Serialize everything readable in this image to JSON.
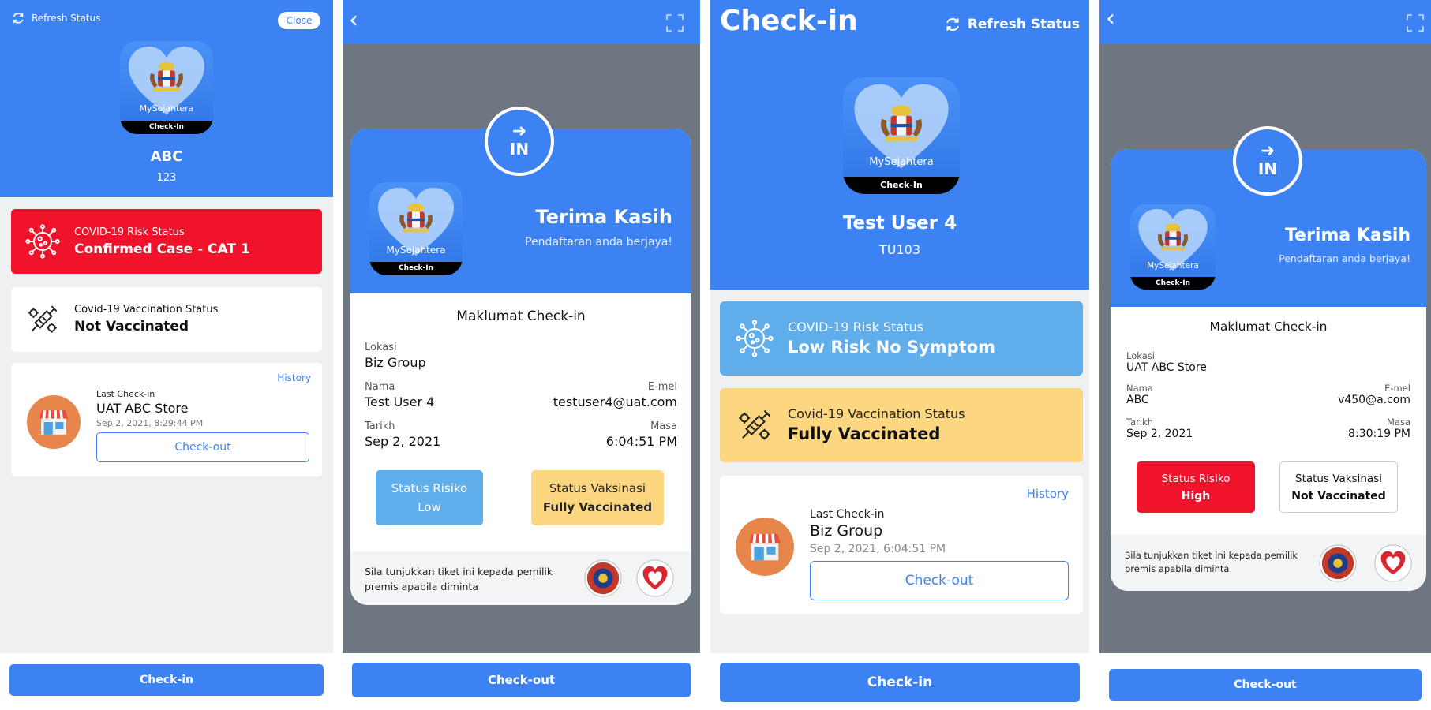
{
  "colors": {
    "brand": "#3d82f2",
    "danger": "#f0132b",
    "risk_low": "#5fadea",
    "vacc_full": "#fcd77f"
  },
  "panel1": {
    "refresh_label": "Refresh Status",
    "close_label": "Close",
    "app": {
      "brand": "MySejahtera",
      "band": "Check-In"
    },
    "user_name": "ABC",
    "user_id": "123",
    "risk": {
      "title": "COVID-19 Risk Status",
      "value": "Confirmed Case - CAT 1"
    },
    "vaccination": {
      "title": "Covid-19 Vaccination Status",
      "value": "Not Vaccinated"
    },
    "last_checkin": {
      "history": "History",
      "label": "Last Check-in",
      "place": "UAT ABC Store",
      "time": "Sep 2, 2021, 8:29:44 PM",
      "checkout": "Check-out"
    },
    "bottom_button": "Check-in"
  },
  "panel2": {
    "in_label": "IN",
    "app": {
      "brand": "MySejahtera",
      "band": "Check-In"
    },
    "thanks": "Terima Kasih",
    "success": "Pendaftaran anda berjaya!",
    "section_title": "Maklumat Check-in",
    "lokasi_label": "Lokasi",
    "lokasi": "Biz Group",
    "nama_label": "Nama",
    "nama": "Test User 4",
    "email_label": "E-mel",
    "email": "testuser4@uat.com",
    "tarikh_label": "Tarikh",
    "tarikh": "Sep 2, 2021",
    "masa_label": "Masa",
    "masa": "6:04:51 PM",
    "risk_label": "Status Risiko",
    "risk_value": "Low",
    "vacc_label": "Status Vaksinasi",
    "vacc_value": "Fully Vaccinated",
    "footer": "Sila tunjukkan tiket ini kepada pemilik premis apabila diminta",
    "bottom_button": "Check-out"
  },
  "panel3": {
    "title": "Check-in",
    "refresh_label": "Refresh Status",
    "app": {
      "brand": "MySejahtera",
      "band": "Check-In"
    },
    "user_name": "Test User 4",
    "user_id": "TU103",
    "risk": {
      "title": "COVID-19 Risk Status",
      "value": "Low Risk No Symptom"
    },
    "vaccination": {
      "title": "Covid-19 Vaccination Status",
      "value": "Fully Vaccinated"
    },
    "last_checkin": {
      "history": "History",
      "label": "Last Check-in",
      "place": "Biz Group",
      "time": "Sep 2, 2021, 6:04:51 PM",
      "checkout": "Check-out"
    },
    "bottom_button": "Check-in"
  },
  "panel4": {
    "in_label": "IN",
    "app": {
      "brand": "MySejahtera",
      "band": "Check-In"
    },
    "thanks": "Terima Kasih",
    "success": "Pendaftaran anda berjaya!",
    "section_title": "Maklumat Check-in",
    "lokasi_label": "Lokasi",
    "lokasi": "UAT ABC Store",
    "nama_label": "Nama",
    "nama": "ABC",
    "email_label": "E-mel",
    "email": "v450@a.com",
    "tarikh_label": "Tarikh",
    "tarikh": "Sep 2, 2021",
    "masa_label": "Masa",
    "masa": "8:30:19 PM",
    "risk_label": "Status Risiko",
    "risk_value": "High",
    "vacc_label": "Status Vaksinasi",
    "vacc_value": "Not Vaccinated",
    "footer": "Sila tunjukkan tiket ini kepada pemilik premis apabila diminta",
    "bottom_button": "Check-out"
  }
}
